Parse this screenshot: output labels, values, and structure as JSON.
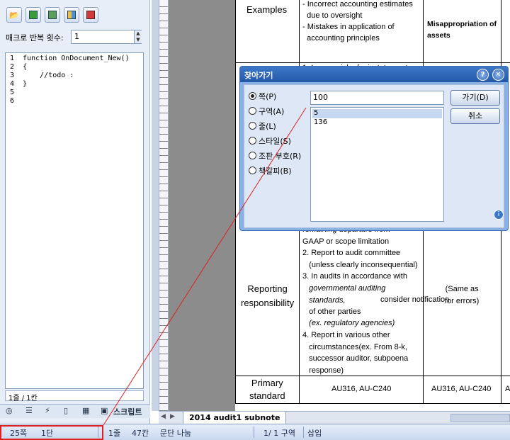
{
  "left_panel": {
    "repeat_label": "매크로 반복 횟수:",
    "repeat_value": "1",
    "code_lines": [
      {
        "num": "1",
        "text": "function OnDocument_New()"
      },
      {
        "num": "2",
        "text": "{"
      },
      {
        "num": "3",
        "text": "    //todo :"
      },
      {
        "num": "4",
        "text": "}"
      },
      {
        "num": "5",
        "text": ""
      },
      {
        "num": "6",
        "text": ""
      }
    ],
    "line_col": "1줄 / 1칸",
    "script_tab": "스크립트"
  },
  "document": {
    "row1_label": "Examples",
    "row1_col2": "- Incorrect accounting estimates\n  due to oversight\n- Mistakes in application of\n  accounting principles",
    "row1_col3": "Misappropriation of\nassets",
    "row2_col2_partial": "1. Lessen risk of misstatement",
    "row3_label": "Reporting\nresponsibility",
    "row3_col2_a": "remaining departure from\nGAAP or scope limitation\n2. Report to audit committee\n   (unless clearly inconsequential)\n3. In audits in accordance with",
    "row3_col2_b": "   governmental auditing\n   standards,",
    "row3_col2_c": " consider notification",
    "row3_col2_d": "   of other parties",
    "row3_col2_e": "   (ex. regulatory agencies)",
    "row3_col2_f": "4. Report in various other\n   circumstances(ex. From 8-k,\n   successor auditor, subpoena\n   response)",
    "row3_col3": "(Same as\nfor errors)",
    "row4_label": "Primary\nstandard",
    "row4_col2": "AU316, AU-C240",
    "row4_col3": "AU316, AU-C240",
    "row4_col4": "A"
  },
  "tabbar": {
    "doc_tab": "2014 audit1 subnote"
  },
  "statusbar": {
    "page": "25쪽",
    "column": "1단",
    "line": "1줄",
    "char": "47칸",
    "para": "문단 나눔",
    "section": "1/  1 구역",
    "insert": "삽입"
  },
  "dialog": {
    "title": "찾아가기",
    "radios": [
      {
        "label": "쪽(P)",
        "checked": true
      },
      {
        "label": "구역(A)",
        "checked": false
      },
      {
        "label": "줄(L)",
        "checked": false
      },
      {
        "label": "스타일(S)",
        "checked": false
      },
      {
        "label": "조판 부호(R)",
        "checked": false
      },
      {
        "label": "책갈피(B)",
        "checked": false
      }
    ],
    "input_value": "100",
    "list_items": [
      {
        "text": "5",
        "selected": true
      },
      {
        "text": "136",
        "selected": false
      }
    ],
    "goto_button": "가기(D)",
    "cancel_button": "취소"
  },
  "colors": {
    "highlight": "#e02020",
    "title_bar": "#2e65b5"
  }
}
